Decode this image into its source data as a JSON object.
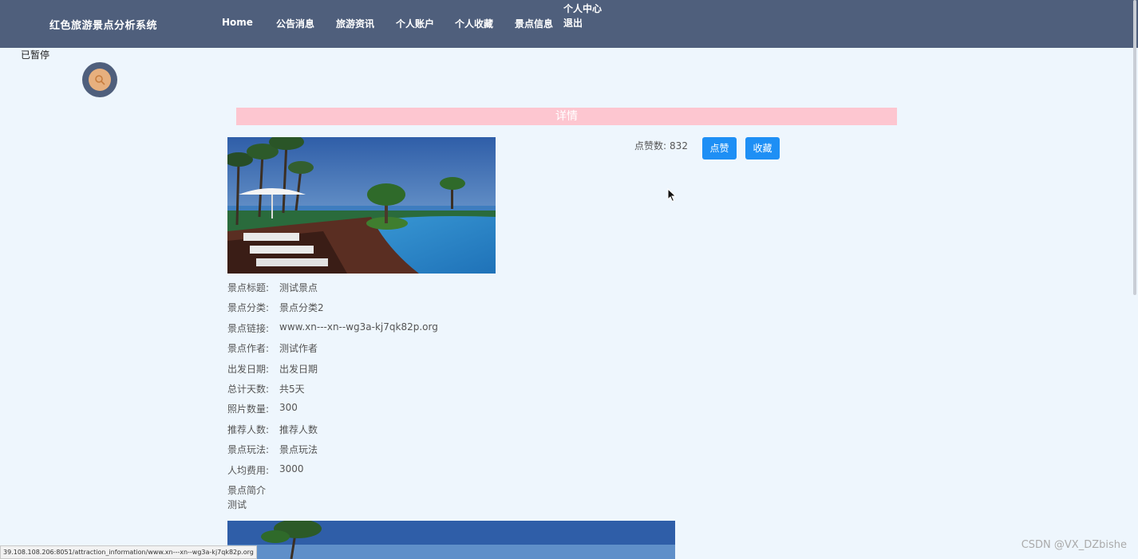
{
  "header": {
    "brand": "红色旅游景点分析系统",
    "nav": [
      "Home",
      "公告消息",
      "旅游资讯",
      "个人账户",
      "个人收藏",
      "景点信息"
    ],
    "user_center": "个人中心",
    "logout": "退出"
  },
  "overlay": {
    "paused": "已暂停"
  },
  "detail": {
    "banner": "详情",
    "likes_label": "点赞数:",
    "likes_count": "832",
    "like_button": "点赞",
    "favorite_button": "收藏",
    "fields": [
      {
        "label": "景点标题:",
        "value": "测试景点"
      },
      {
        "label": "景点分类:",
        "value": "景点分类2"
      },
      {
        "label": "景点链接:",
        "value": "www.xn---xn--wg3a-kj7qk82p.org"
      },
      {
        "label": "景点作者:",
        "value": "测试作者"
      },
      {
        "label": "出发日期:",
        "value": "出发日期"
      },
      {
        "label": "总计天数:",
        "value": "共5天"
      },
      {
        "label": "照片数量:",
        "value": "300"
      },
      {
        "label": "推荐人数:",
        "value": "推荐人数"
      },
      {
        "label": "景点玩法:",
        "value": "景点玩法"
      },
      {
        "label": "人均费用:",
        "value": "3000"
      }
    ],
    "intro_label": "景点简介",
    "intro_value": "测试"
  },
  "status_bar": {
    "url": "39.108.108.206:8051/attraction_information/www.xn---xn--wg3a-kj7qk82p.org"
  },
  "watermark": "CSDN @VX_DZbishe",
  "colors": {
    "nav_bg": "#4f5f7c",
    "page_bg": "#eef6fd",
    "banner": "#fdc6d0",
    "button": "#1e8ff5"
  }
}
